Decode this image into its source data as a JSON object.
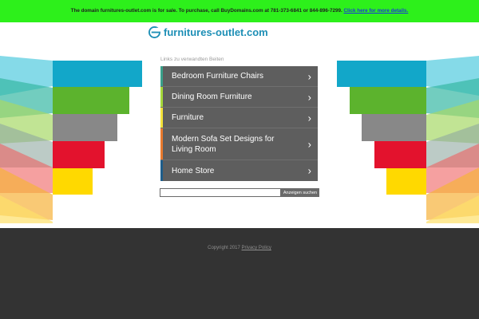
{
  "topbar": {
    "message": "The domain furnitures-outlet.com is for sale. To purchase, call BuyDomains.com at 781-373-6841 or 844-896-7299.",
    "link": "Click here for more details."
  },
  "logo": {
    "text": "furnitures-outlet.com"
  },
  "links_caption": "Links zu verwandten Beiten",
  "menu": [
    {
      "label": "Bedroom Furniture Chairs",
      "accent": "#3aa08a"
    },
    {
      "label": "Dining Room Furniture",
      "accent": "#a5d83a"
    },
    {
      "label": "Furniture",
      "accent": "#f3e23a"
    },
    {
      "label": "Modern Sofa Set Designs for Living Room",
      "accent": "#e87a2e"
    },
    {
      "label": "Home Store",
      "accent": "#1f5d8a"
    }
  ],
  "search": {
    "value": "",
    "button": "Anzeigen suchen"
  },
  "footer": {
    "copyright": "Copyright 2017",
    "privacy": "Privacy Policy"
  },
  "colors": {
    "topbar": "#2df01b",
    "stripes": [
      "#12a7c9",
      "#5cb32d",
      "#888888",
      "#e3122d",
      "#ffd900"
    ]
  }
}
